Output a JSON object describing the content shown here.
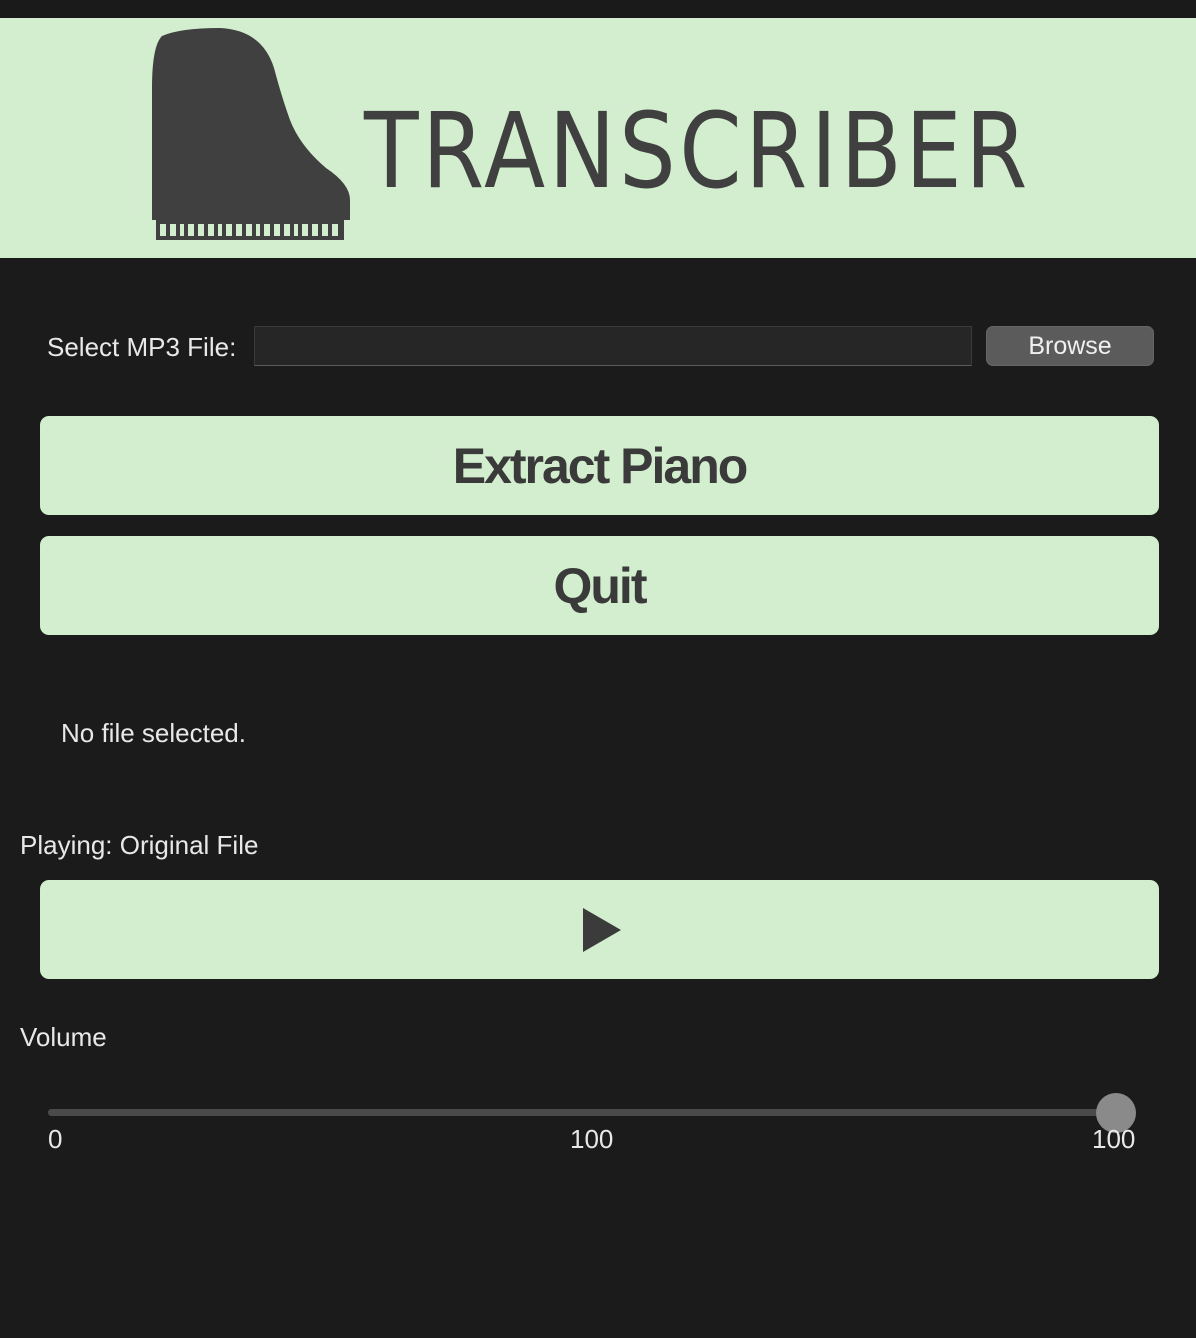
{
  "banner": {
    "title": "TRANSCRIBER",
    "logo_icon": "grand-piano-icon",
    "bg_color": "#d2eece",
    "text_color": "#404040"
  },
  "file_select": {
    "label": "Select MP3 File:",
    "value": "",
    "placeholder": "",
    "browse_label": "Browse"
  },
  "actions": {
    "extract_label": "Extract Piano",
    "quit_label": "Quit"
  },
  "status": {
    "text": "No file selected."
  },
  "player": {
    "playing_label": "Playing: Original File",
    "play_icon": "play-icon"
  },
  "volume": {
    "label": "Volume",
    "min": 0,
    "max": 100,
    "value": 100,
    "tick_labels": [
      "0",
      "100",
      "100"
    ]
  },
  "colors": {
    "background": "#1b1b1b",
    "accent": "#d2eece",
    "button_text": "#3a3a3a"
  }
}
